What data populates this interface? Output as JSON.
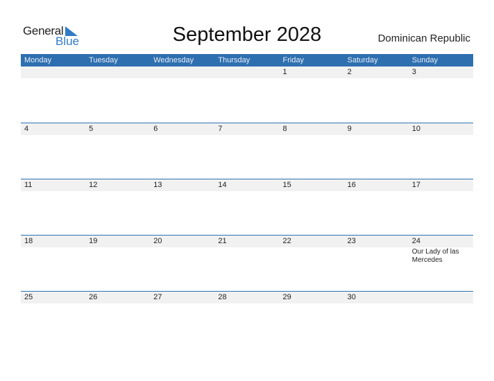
{
  "logo": {
    "general": "General",
    "blue": "Blue"
  },
  "title": "September 2028",
  "country": "Dominican Republic",
  "weekdays": [
    "Monday",
    "Tuesday",
    "Wednesday",
    "Thursday",
    "Friday",
    "Saturday",
    "Sunday"
  ],
  "weeks": [
    {
      "days": [
        "",
        "",
        "",
        "",
        "1",
        "2",
        "3"
      ],
      "events": [
        "",
        "",
        "",
        "",
        "",
        "",
        ""
      ]
    },
    {
      "days": [
        "4",
        "5",
        "6",
        "7",
        "8",
        "9",
        "10"
      ],
      "events": [
        "",
        "",
        "",
        "",
        "",
        "",
        ""
      ]
    },
    {
      "days": [
        "11",
        "12",
        "13",
        "14",
        "15",
        "16",
        "17"
      ],
      "events": [
        "",
        "",
        "",
        "",
        "",
        "",
        ""
      ]
    },
    {
      "days": [
        "18",
        "19",
        "20",
        "21",
        "22",
        "23",
        "24"
      ],
      "events": [
        "",
        "",
        "",
        "",
        "",
        "",
        "Our Lady of las Mercedes"
      ]
    },
    {
      "days": [
        "25",
        "26",
        "27",
        "28",
        "29",
        "30",
        ""
      ],
      "events": [
        "",
        "",
        "",
        "",
        "",
        "",
        ""
      ]
    }
  ],
  "colors": {
    "accent": "#2e6fb0",
    "row_bg": "#f1f1f1",
    "logo_blue": "#2f7bc6"
  }
}
